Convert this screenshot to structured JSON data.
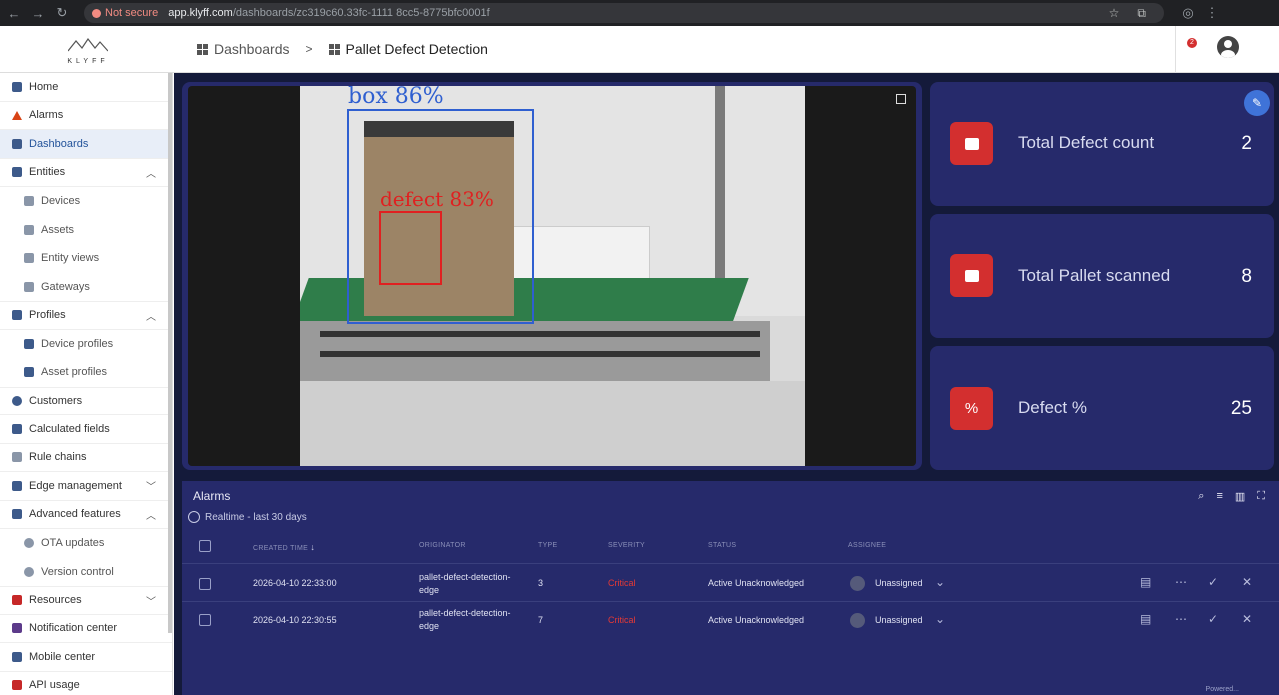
{
  "browser": {
    "not_secure": "Not secure",
    "url_host": "app.klyff.com",
    "url_path": "/dashboards/zc319c60.33fc-1111 8cc5-8775bfc0001f"
  },
  "header": {
    "logo_text": "KLYFF",
    "breadcrumb_root": "Dashboards",
    "breadcrumb_sep": ">",
    "breadcrumb_current": "Pallet Defect Detection",
    "notification_count": "2"
  },
  "sidebar": {
    "items": [
      {
        "label": "Home"
      },
      {
        "label": "Alarms"
      },
      {
        "label": "Dashboards"
      },
      {
        "label": "Entities"
      },
      {
        "label": "Devices"
      },
      {
        "label": "Assets"
      },
      {
        "label": "Entity views"
      },
      {
        "label": "Gateways"
      },
      {
        "label": "Profiles"
      },
      {
        "label": "Device profiles"
      },
      {
        "label": "Asset profiles"
      },
      {
        "label": "Customers"
      },
      {
        "label": "Calculated fields"
      },
      {
        "label": "Rule chains"
      },
      {
        "label": "Edge management"
      },
      {
        "label": "Advanced features"
      },
      {
        "label": "OTA updates"
      },
      {
        "label": "Version control"
      },
      {
        "label": "Resources"
      },
      {
        "label": "Notification center"
      },
      {
        "label": "Mobile center"
      },
      {
        "label": "API usage"
      }
    ]
  },
  "camera": {
    "box_label": "box 86%",
    "defect_label": "defect 83%"
  },
  "stats": [
    {
      "label": "Total Defect count",
      "value": "2",
      "icon": "pallet-icon"
    },
    {
      "label": "Total Pallet scanned",
      "value": "8",
      "icon": "pallet-icon"
    },
    {
      "label": "Defect %",
      "value": "25",
      "icon": "percent-icon",
      "glyph": "%"
    }
  ],
  "alarms": {
    "title": "Alarms",
    "timewindow": "Realtime - last 30 days",
    "columns": {
      "created_time": "CREATED TIME",
      "originator": "ORIGINATOR",
      "type": "TYPE",
      "severity": "SEVERITY",
      "status": "STATUS",
      "assignee": "ASSIGNEE"
    },
    "rows": [
      {
        "created_time": "2026-04-10 22:33:00",
        "originator_1": "pallet-defect-detection-",
        "originator_2": "edge",
        "type": "3",
        "severity": "Critical",
        "status": "Active Unacknowledged",
        "assignee": "Unassigned"
      },
      {
        "created_time": "2026-04-10 22:30:55",
        "originator_1": "pallet-defect-detection-",
        "originator_2": "edge",
        "type": "7",
        "severity": "Critical",
        "status": "Active Unacknowledged",
        "assignee": "Unassigned"
      }
    ],
    "powered": "Powered..."
  },
  "colors": {
    "dashboard_bg": "#141a3a",
    "card_bg": "#262a6b",
    "accent_red": "#d32f2f",
    "active_nav": "#23539a"
  }
}
